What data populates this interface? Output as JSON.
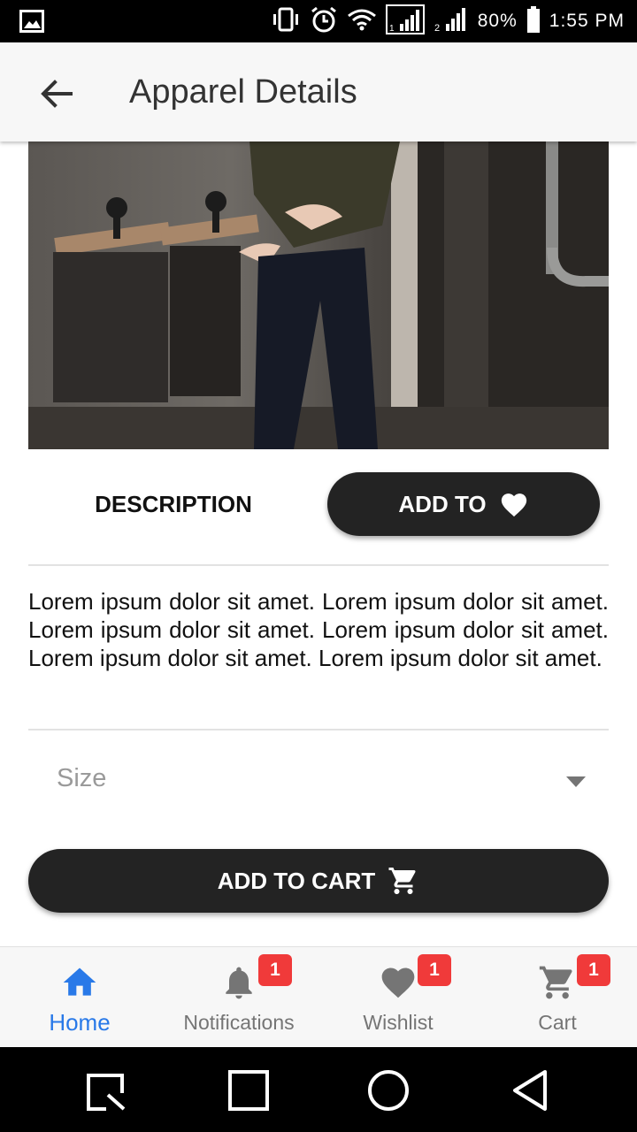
{
  "status_bar": {
    "battery_text": "80%",
    "time": "1:55 PM",
    "icons": [
      "gallery-icon",
      "vibrate-icon",
      "alarm-icon",
      "wifi-icon",
      "signal-1-icon",
      "signal-2-icon",
      "battery-icon"
    ]
  },
  "app_bar": {
    "title": "Apparel Details",
    "back_icon": "arrow-back-icon"
  },
  "product": {
    "image_desc": "apparel photo",
    "description_tab": "DESCRIPTION",
    "add_to_label": "ADD TO",
    "add_to_icon": "heart-icon",
    "description_text": "Lorem ipsum dolor sit amet. Lorem ipsum dolor sit amet. Lorem ipsum dolor sit amet. Lorem ipsum dolor sit amet. Lorem ipsum dolor sit amet. Lorem ipsum dolor sit amet.",
    "size_placeholder": "Size",
    "add_to_cart_label": "ADD TO CART",
    "add_to_cart_icon": "cart-icon"
  },
  "bottom_nav": {
    "items": [
      {
        "label": "Home",
        "icon": "home-icon",
        "active": true,
        "badge": ""
      },
      {
        "label": "Notifications",
        "icon": "bell-icon",
        "active": false,
        "badge": "1"
      },
      {
        "label": "Wishlist",
        "icon": "heart-icon",
        "active": false,
        "badge": "1"
      },
      {
        "label": "Cart",
        "icon": "cart-icon",
        "active": false,
        "badge": "1"
      }
    ]
  },
  "system_nav": {
    "icons": [
      "recents-search-icon",
      "overview-square-icon",
      "home-circle-icon",
      "back-triangle-icon"
    ]
  },
  "colors": {
    "accent_active": "#2979e8",
    "button_dark": "#232323",
    "badge_red": "#f03a3a"
  }
}
